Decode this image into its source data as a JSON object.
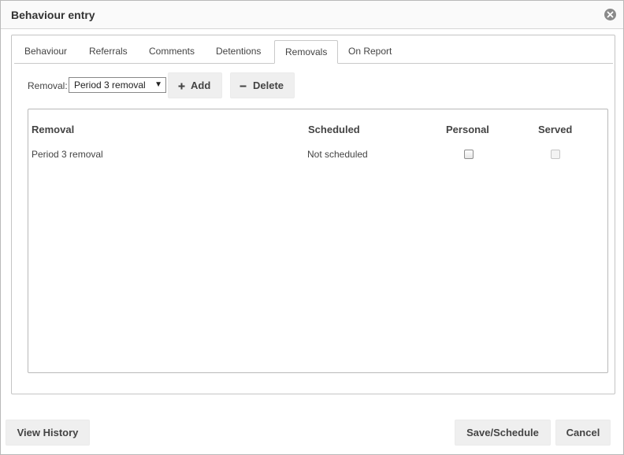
{
  "dialog": {
    "title": "Behaviour entry"
  },
  "tabs": [
    {
      "label": "Behaviour",
      "active": false
    },
    {
      "label": "Referrals",
      "active": false
    },
    {
      "label": "Comments",
      "active": false
    },
    {
      "label": "Detentions",
      "active": false
    },
    {
      "label": "Removals",
      "active": true
    },
    {
      "label": "On Report",
      "active": false
    }
  ],
  "toolbar": {
    "removal_label": "Removal:",
    "removal_selected": "Period 3 removal",
    "add_label": "Add",
    "delete_label": "Delete"
  },
  "table": {
    "columns": [
      "Removal",
      "Scheduled",
      "Personal",
      "Served"
    ],
    "rows": [
      {
        "removal": "Period 3 removal",
        "scheduled": "Not scheduled",
        "personal": false,
        "served": false
      }
    ]
  },
  "footer": {
    "history_label": "View History",
    "save_label": "Save/Schedule",
    "cancel_label": "Cancel"
  },
  "icons": {
    "close": "close-icon",
    "add": "plus-icon",
    "delete": "minus-icon",
    "dropdown": "caret-down-icon"
  }
}
